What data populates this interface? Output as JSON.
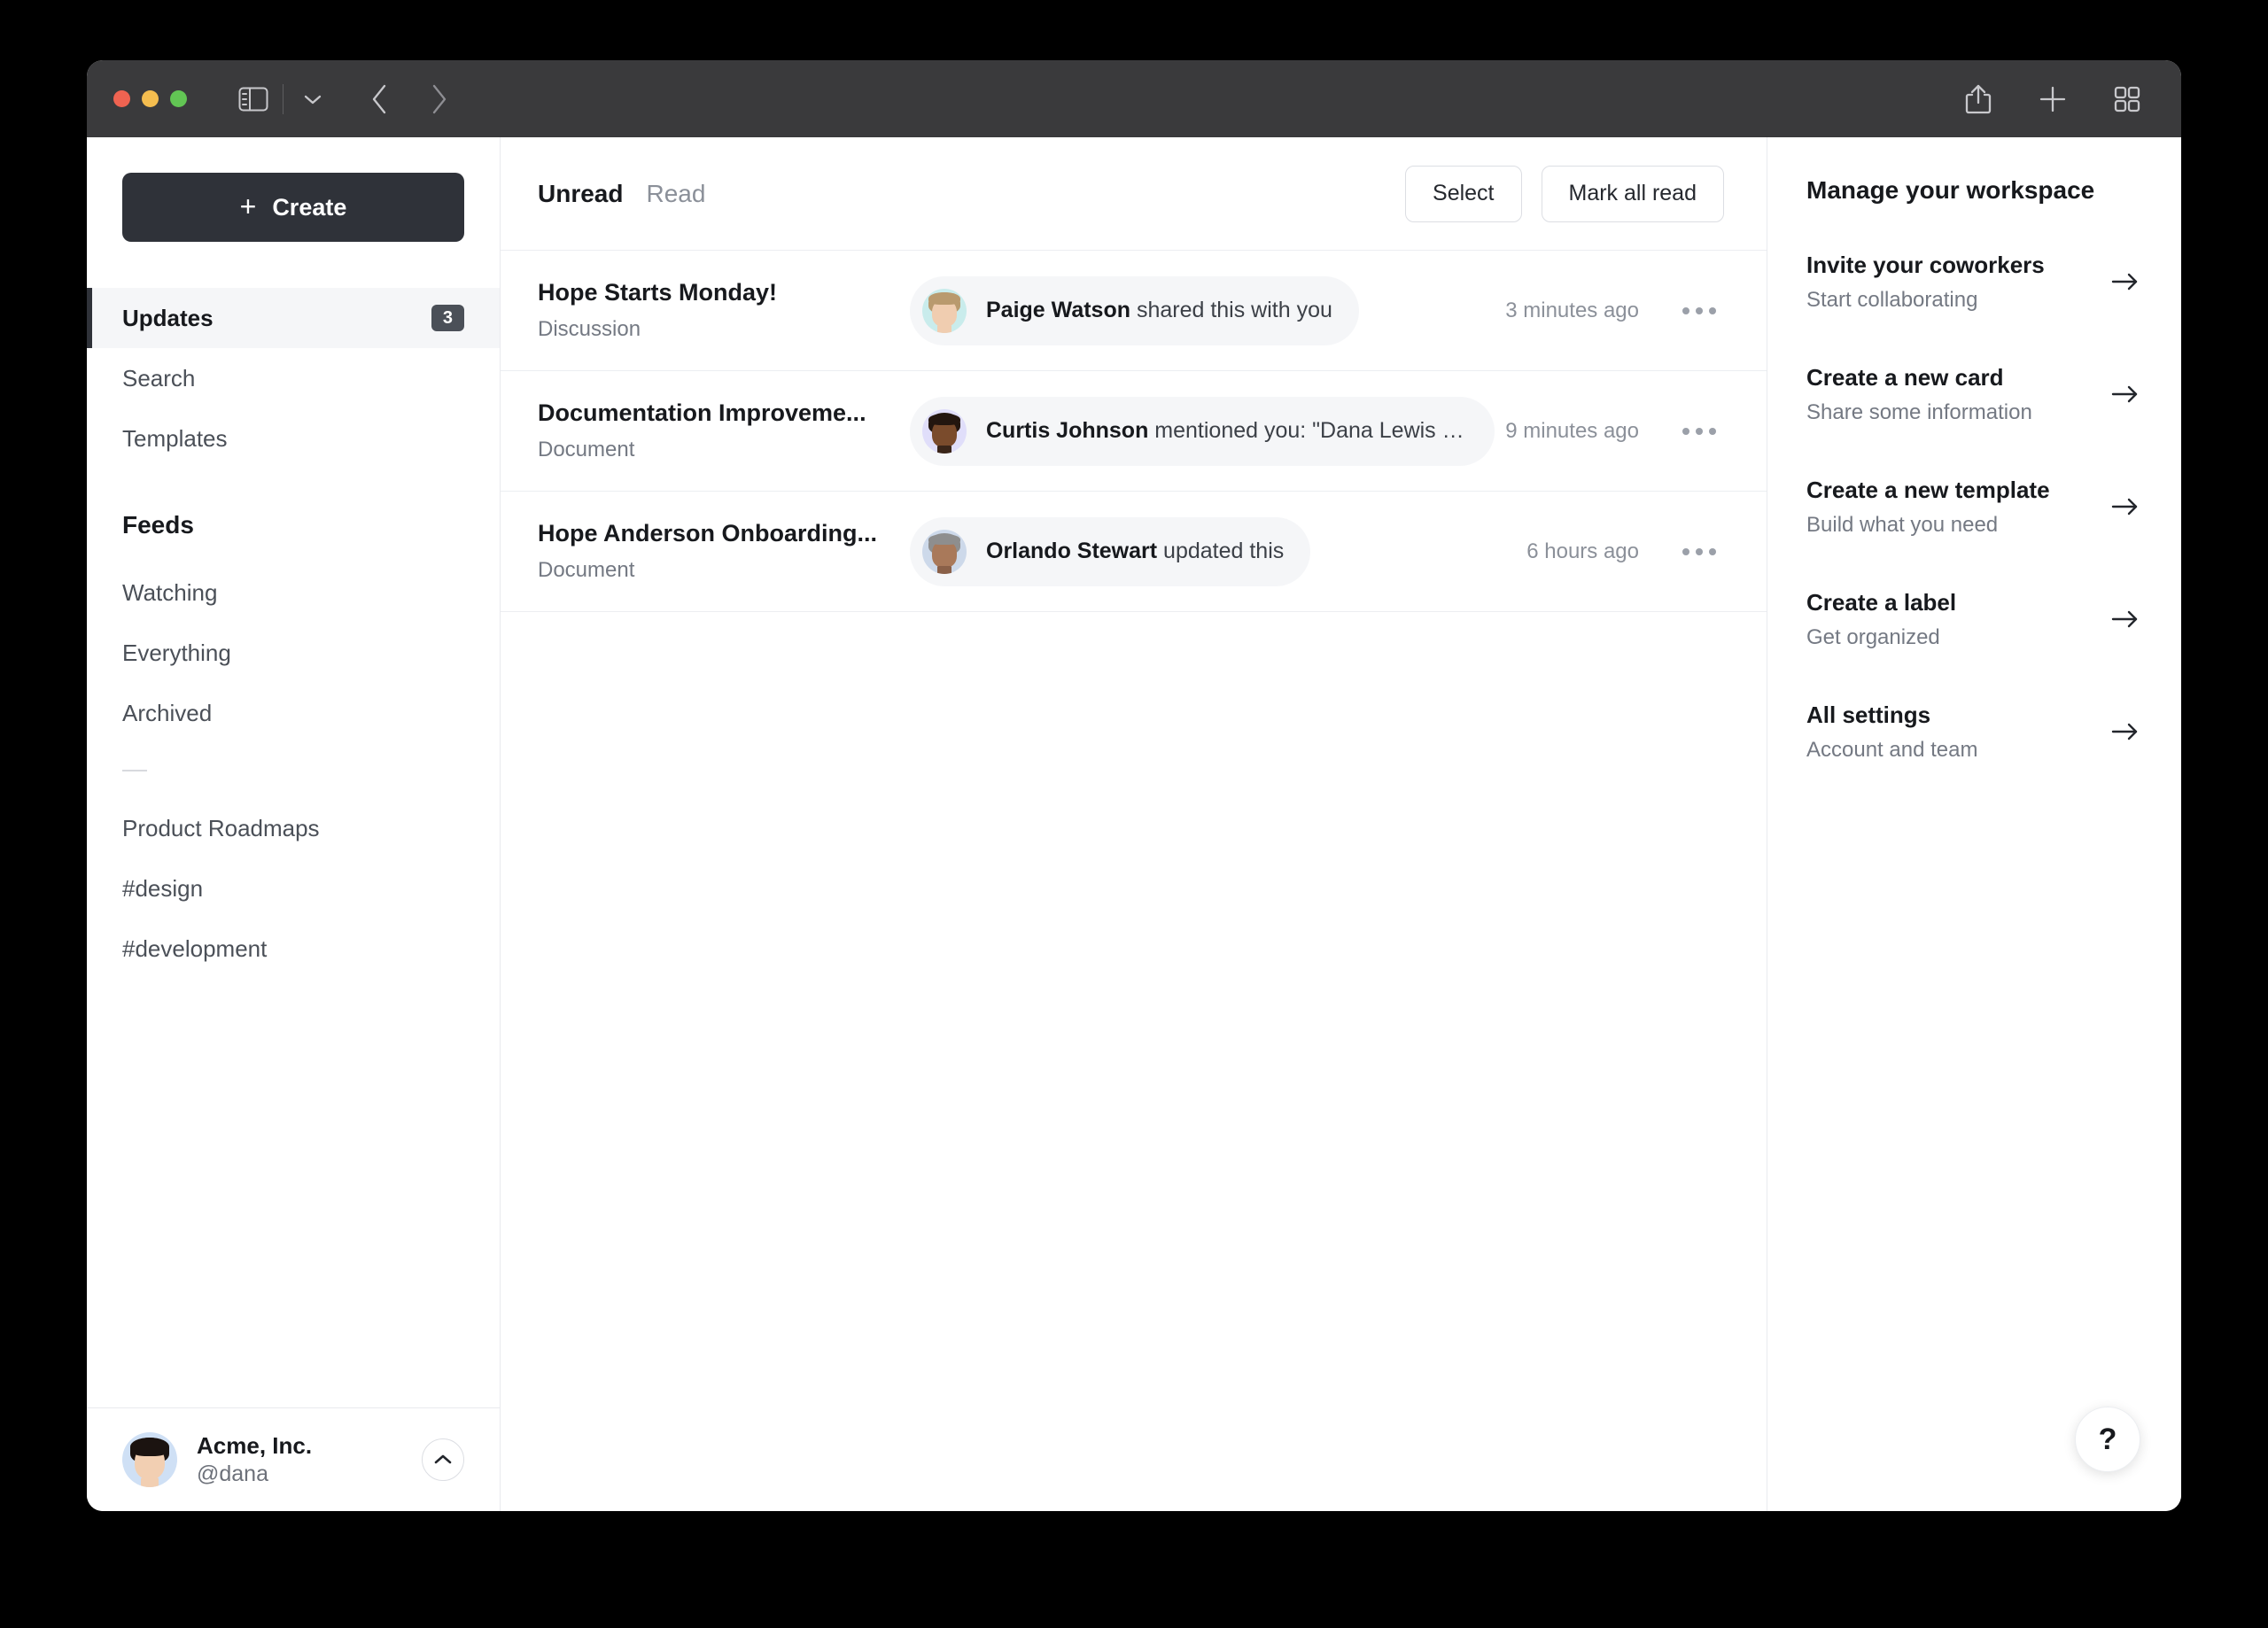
{
  "window": {
    "titlebar": {
      "traffic_lights": [
        "close",
        "minimize",
        "zoom"
      ],
      "sidebar_toggle_icon": "sidebar-icon",
      "dropdown_icon": "chevron-down-icon",
      "back_icon": "chevron-left-icon",
      "forward_icon": "chevron-right-icon",
      "share_icon": "share-icon",
      "new_tab_icon": "plus-icon",
      "tab_overview_icon": "grid-icon"
    }
  },
  "sidebar": {
    "create_label": "Create",
    "create_icon": "plus-icon",
    "nav": [
      {
        "label": "Updates",
        "badge": "3",
        "active": true
      },
      {
        "label": "Search",
        "badge": "",
        "active": false
      },
      {
        "label": "Templates",
        "badge": "",
        "active": false
      }
    ],
    "feeds_title": "Feeds",
    "feeds": [
      {
        "label": "Watching"
      },
      {
        "label": "Everything"
      },
      {
        "label": "Archived"
      }
    ],
    "channels": [
      {
        "label": "Product Roadmaps"
      },
      {
        "label": "#design"
      },
      {
        "label": "#development"
      }
    ],
    "account": {
      "name": "Acme, Inc.",
      "handle": "@dana",
      "avatar": "dana-avatar",
      "toggle_icon": "chevron-up-icon"
    }
  },
  "main": {
    "tabs": [
      {
        "label": "Unread",
        "active": true
      },
      {
        "label": "Read",
        "active": false
      }
    ],
    "actions": {
      "select_label": "Select",
      "mark_all_read_label": "Mark all read"
    },
    "rows": [
      {
        "title": "Hope Starts Monday!",
        "type": "Discussion",
        "actor": "Paige Watson",
        "action": " shared this with you",
        "time": "3 minutes ago",
        "avatar_bg": "#c9ecec",
        "skin": "#f0cdb0",
        "hair": "#b99a6e",
        "more_icon": "ellipsis-icon"
      },
      {
        "title": "Documentation Improveme...",
        "type": "Document",
        "actor": "Curtis Johnson",
        "action": " mentioned you:  \"Dana Lewis is ...",
        "time": "9 minutes ago",
        "avatar_bg": "#e0defa",
        "skin": "#7a4b2c",
        "hair": "#23160f",
        "more_icon": "ellipsis-icon"
      },
      {
        "title": "Hope Anderson Onboarding...",
        "type": "Document",
        "actor": "Orlando Stewart",
        "action": " updated this",
        "time": "6 hours ago",
        "avatar_bg": "#cdd9ea",
        "skin": "#a9795a",
        "hair": "#8e8e8e",
        "more_icon": "ellipsis-icon"
      }
    ]
  },
  "right_panel": {
    "title": "Manage your workspace",
    "items": [
      {
        "label": "Invite your coworkers",
        "desc": "Start collaborating",
        "arrow_icon": "arrow-right-icon"
      },
      {
        "label": "Create a new card",
        "desc": "Share some information",
        "arrow_icon": "arrow-right-icon"
      },
      {
        "label": "Create a new template",
        "desc": "Build what you need",
        "arrow_icon": "arrow-right-icon"
      },
      {
        "label": "Create a label",
        "desc": "Get organized",
        "arrow_icon": "arrow-right-icon"
      },
      {
        "label": "All settings",
        "desc": "Account and team",
        "arrow_icon": "arrow-right-icon"
      }
    ],
    "help_label": "?"
  },
  "colors": {
    "accent_dark": "#2f3239",
    "titlebar": "#3a3a3c",
    "active_row_bg": "#f5f6f8",
    "text_primary": "#17191d",
    "text_muted": "#747983"
  }
}
